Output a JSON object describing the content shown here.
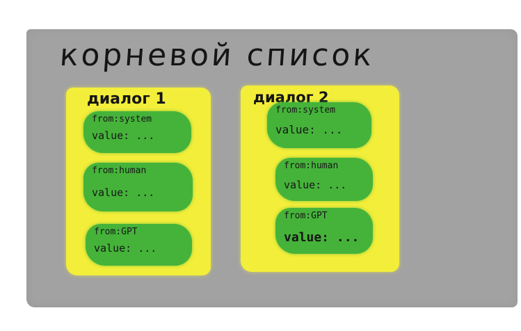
{
  "root": {
    "title": "корневой список"
  },
  "dialogs": [
    {
      "title": "диалог 1",
      "messages": [
        {
          "from": "from:system",
          "value": "value: ..."
        },
        {
          "from": "from:human",
          "value": "value: ..."
        },
        {
          "from": "from:GPT",
          "value": "value: ..."
        }
      ]
    },
    {
      "title": "диалог 2",
      "messages": [
        {
          "from": "from:system",
          "value": "value: ..."
        },
        {
          "from": "from:human",
          "value": "value: ..."
        },
        {
          "from": "from:GPT",
          "value": "value: ..."
        }
      ]
    }
  ],
  "colors": {
    "root": "#a2a2a2",
    "dialog": "#f3ee3a",
    "message": "#45b33a",
    "text": "#151515"
  }
}
